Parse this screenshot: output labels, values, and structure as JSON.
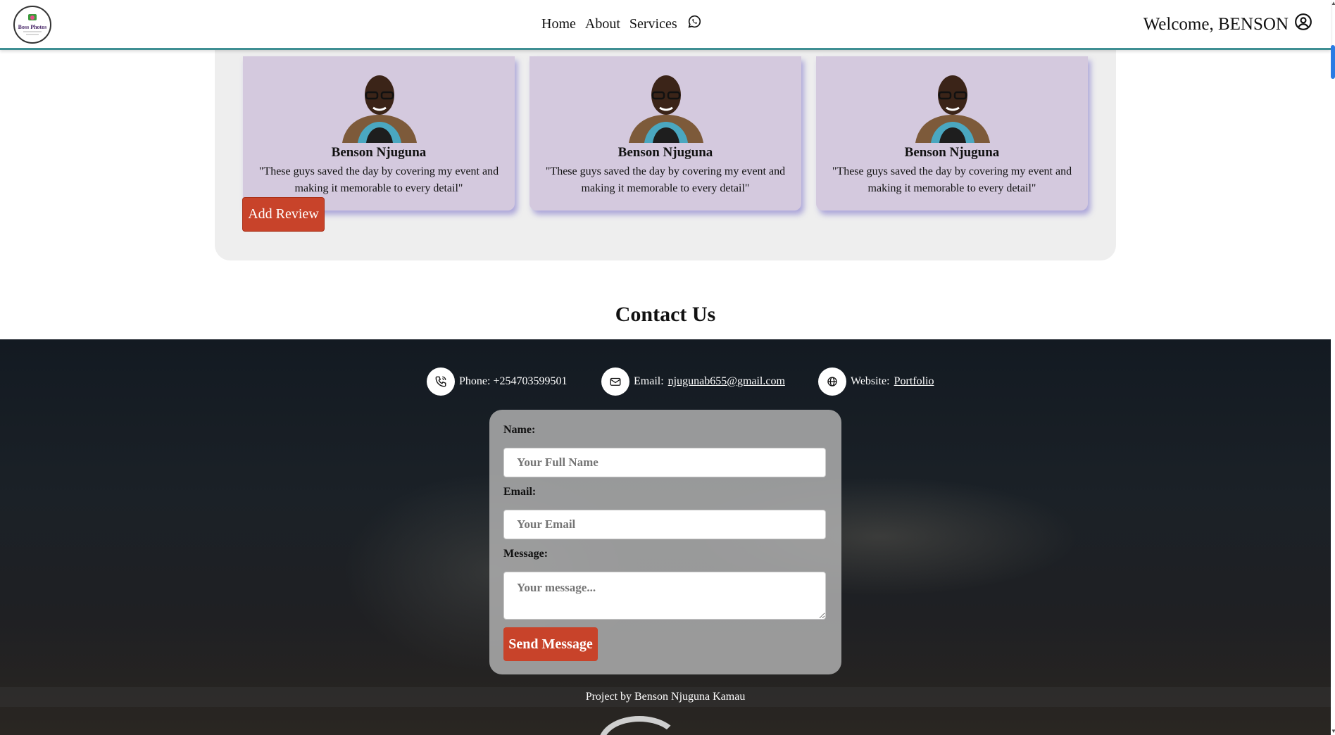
{
  "header": {
    "logo_alt": "Boss Photos",
    "nav": {
      "home": "Home",
      "about": "About",
      "services": "Services"
    },
    "welcome": "Welcome, BENSON"
  },
  "reviews": {
    "cards": [
      {
        "name": "Benson Njuguna",
        "text": "\"These guys saved the day by covering my event and making it memorable to every detail\""
      },
      {
        "name": "Benson Njuguna",
        "text": "\"These guys saved the day by covering my event and making it memorable to every detail\""
      },
      {
        "name": "Benson Njuguna",
        "text": "\"These guys saved the day by covering my event and making it memorable to every detail\""
      }
    ],
    "add_review_label": "Add Review"
  },
  "contact": {
    "title": "Contact Us",
    "phone_label": "Phone: +254703599501",
    "email_prefix": "Email: ",
    "email": "njugunab655@gmail.com",
    "website_prefix": "Website: ",
    "website_link": "Portfolio"
  },
  "form": {
    "name_label": "Name:",
    "name_placeholder": "Your Full Name",
    "email_label": "Email:",
    "email_placeholder": "Your Email",
    "message_label": "Message:",
    "message_placeholder": "Your message...",
    "send_label": "Send Message"
  },
  "footer": {
    "credit": "Project by Benson Njuguna Kamau"
  },
  "colors": {
    "accent": "#c8432a",
    "header_border": "#3f8f93",
    "card_bg": "#d4c9de"
  }
}
